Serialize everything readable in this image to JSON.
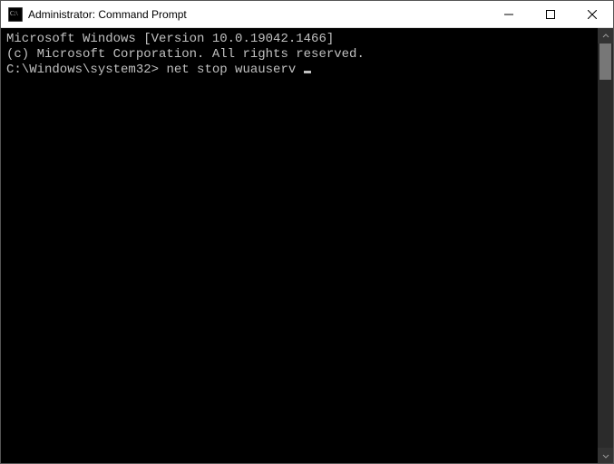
{
  "window": {
    "title": "Administrator: Command Prompt",
    "icon": "cmd-icon"
  },
  "terminal": {
    "line1": "Microsoft Windows [Version 10.0.19042.1466]",
    "line2": "(c) Microsoft Corporation. All rights reserved.",
    "blank": "",
    "prompt": "C:\\Windows\\system32>",
    "command": "net stop wuauserv"
  }
}
